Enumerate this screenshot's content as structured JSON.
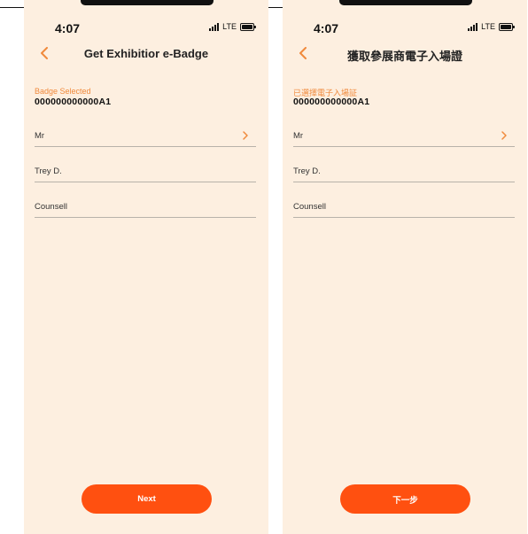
{
  "screens": [
    {
      "status": {
        "time": "4:07",
        "network": "LTE"
      },
      "header": {
        "title": "Get Exhibitior e-Badge"
      },
      "badge": {
        "label": "Badge Selected",
        "value": "000000000000A1"
      },
      "form": {
        "salutation": "Mr",
        "first_name": "Trey D.",
        "last_name": "Counsell"
      },
      "next_button": "Next"
    },
    {
      "status": {
        "time": "4:07",
        "network": "LTE"
      },
      "header": {
        "title": "獲取參展商電子入場證"
      },
      "badge": {
        "label": "已選擇電子入場証",
        "value": "000000000000A1"
      },
      "form": {
        "salutation": "Mr",
        "first_name": "Trey D.",
        "last_name": "Counsell"
      },
      "next_button": "下一步"
    }
  ],
  "colors": {
    "background": "#fdefe0",
    "accent": "#f08a3c",
    "button": "#ff5010"
  }
}
